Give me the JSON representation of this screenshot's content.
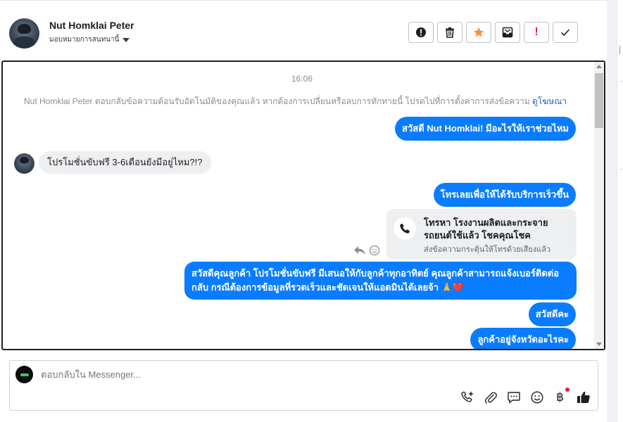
{
  "header": {
    "contact_name": "Nut Homklai Peter",
    "assign_label": "มอบหมายการสนทนานี้",
    "actions": [
      {
        "name": "alert-icon",
        "color": "#1c1e21"
      },
      {
        "name": "trash-icon",
        "color": "#1c1e21"
      },
      {
        "name": "star-icon",
        "color": "#f7923a"
      },
      {
        "name": "archive-icon",
        "color": "#1c1e21"
      },
      {
        "name": "exclamation-icon",
        "color": "#e41e3f"
      },
      {
        "name": "check-icon",
        "color": "#1c1e21"
      }
    ],
    "exclamation_text": "!"
  },
  "conversation": {
    "timestamp": "16:06",
    "notice": "Nut Homklai Peter ตอบกลับข้อความต้อนรับอัตโนมัติของคุณแล้ว หากต้องการเปลี่ยนหรือลบการทักทายนี้ โปรดไปที่การตั้งค่าการส่งข้อความ",
    "notice_link": "ดูโฆษณา",
    "messages": [
      {
        "direction": "out",
        "text": "สวัสดี Nut Homklai! มีอะไรให้เราช่วยไหม"
      },
      {
        "direction": "in",
        "text": "โปรโมชั่นขับฟรี 3-6เดือนยังมีอยู่ไหม?!?"
      },
      {
        "direction": "out",
        "text": "โทรเลยเพื่อให้ได้รับบริการเร็วขึ้น"
      },
      {
        "direction": "out",
        "type": "call-card",
        "title": "โทรหา โรงงานผลิตและกระจายรถยนต์ใช้แล้ว โชคคุณโชค",
        "subtitle": "ส่งข้อความกระตุ้นให้โทรด้วยเสียงแล้ว"
      },
      {
        "direction": "out",
        "text": "สวัสดีคุณลูกค้า โปรโมชั่นขับฟรี มีเสนอให้กับลูกค้าทุกอาทิตย์ คุณลูกค้าสามารถแจ้งเบอร์ติดต่อกลับ กรณีต้องการข้อมูลที่รวดเร็วและชัดเจนให้แอดมินได้เลยจ้า 🙏❤️"
      },
      {
        "direction": "out",
        "text": "สวัสดีคะ"
      },
      {
        "direction": "out",
        "text": "ลูกค้าอยู่จังหวัดอะไรคะ"
      }
    ]
  },
  "composer": {
    "placeholder": "ตอบกลับใน Messenger...",
    "tools": [
      "add-call-icon",
      "attach-icon",
      "saved-reply-icon",
      "emoji-icon",
      "baht-icon",
      "like-icon"
    ],
    "baht_symbol": "฿",
    "accent": "#0a7cff"
  }
}
